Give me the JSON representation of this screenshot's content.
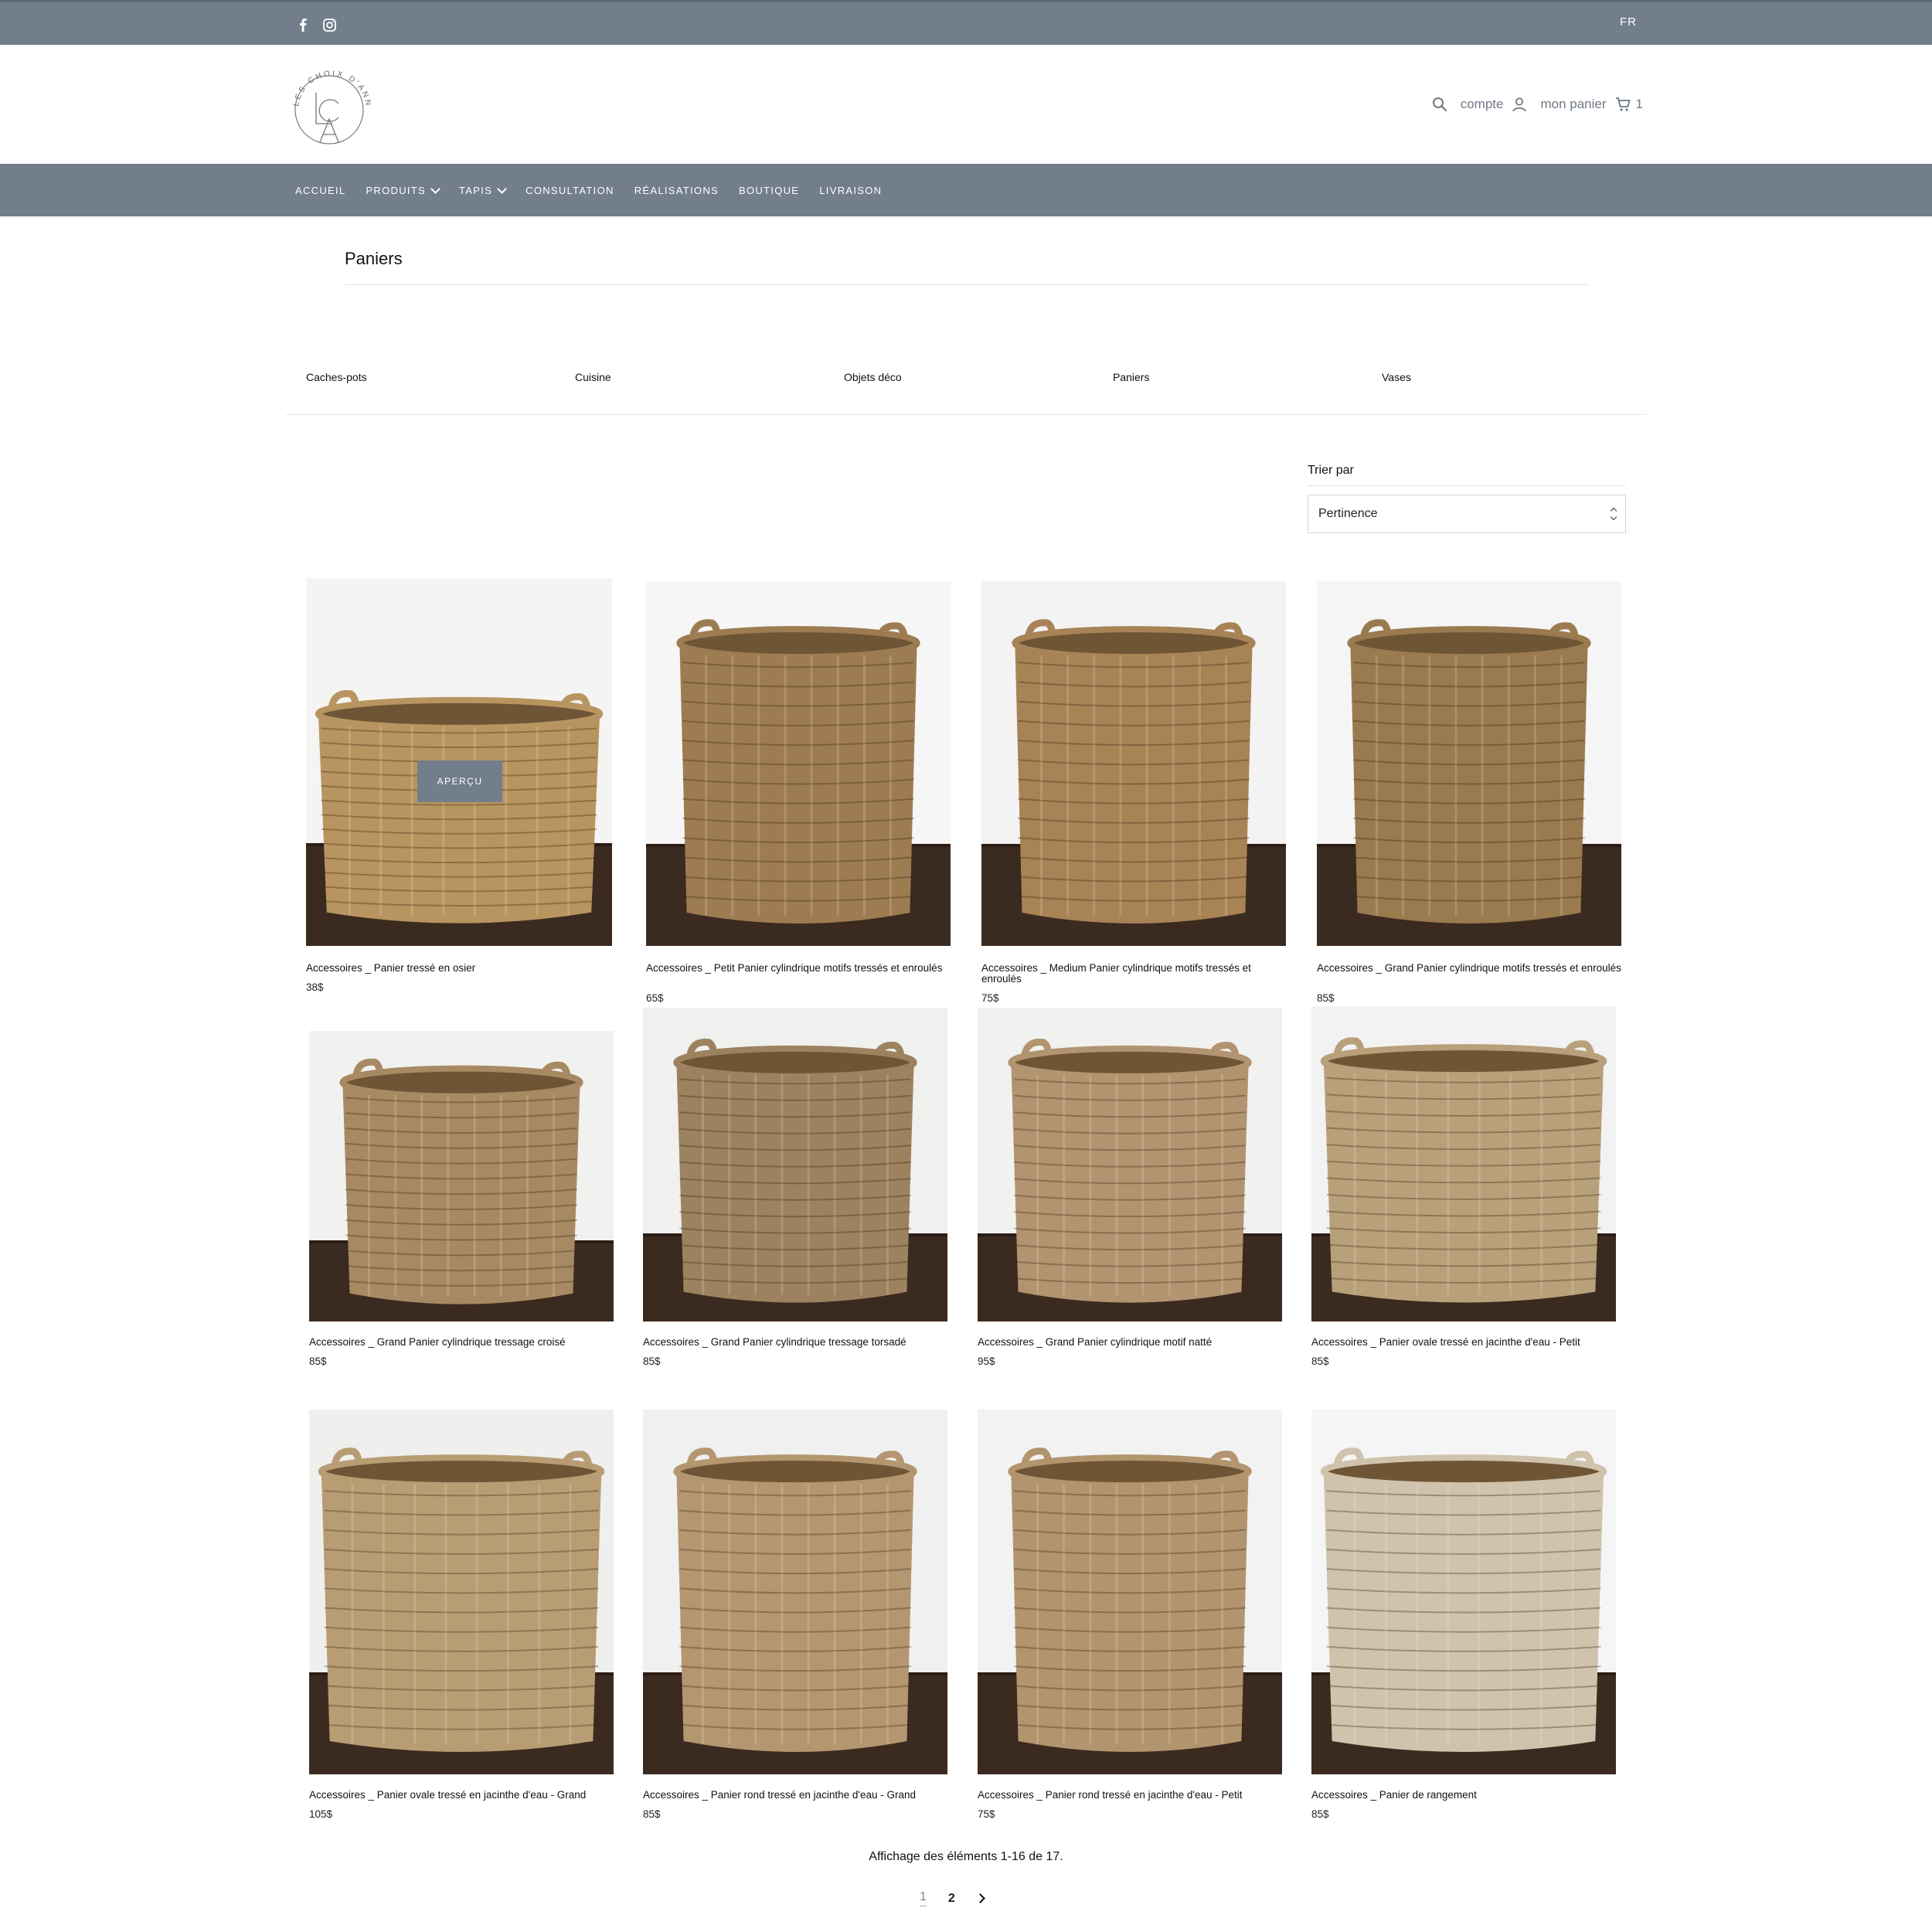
{
  "topbar": {
    "language": "FR",
    "social": [
      "facebook-icon",
      "instagram-icon"
    ]
  },
  "logo": {
    "text": "LES CHOIX D'ANNIE",
    "monogram": "LCA"
  },
  "header": {
    "account_label": "compte",
    "cart_label": "mon panier",
    "cart_count": "1"
  },
  "nav": [
    "ACCUEIL",
    "PRODUITS",
    "TAPIS",
    "CONSULTATION",
    "RÉALISATIONS",
    "BOUTIQUE",
    "LIVRAISON"
  ],
  "page": {
    "title": "Paniers"
  },
  "categories": [
    "Caches-pots",
    "Cuisine",
    "Objets déco",
    "Paniers",
    "Vases"
  ],
  "sort": {
    "label": "Trier par",
    "value": "Pertinence"
  },
  "quickview_label": "APERÇU",
  "products": [
    {
      "name": "Accessoires _ Panier tressé en osier",
      "price": "38$"
    },
    {
      "name": "Accessoires _ Petit Panier cylindrique motifs tressés et enroulés",
      "price": "65$"
    },
    {
      "name": "Accessoires _ Medium Panier cylindrique motifs tressés et enroulés",
      "price": "75$"
    },
    {
      "name": "Accessoires _ Grand Panier cylindrique motifs tressés et enroulés",
      "price": "85$"
    },
    {
      "name": "Accessoires _ Grand Panier cylindrique tressage croisé",
      "price": "85$"
    },
    {
      "name": "Accessoires _ Grand Panier cylindrique tressage torsadé",
      "price": "85$"
    },
    {
      "name": "Accessoires _ Grand Panier cylindrique motif natté",
      "price": "95$"
    },
    {
      "name": "Accessoires _ Panier ovale tressé en jacinthe d'eau - Petit",
      "price": "85$"
    },
    {
      "name": "Accessoires _ Panier ovale tressé en jacinthe d'eau - Grand",
      "price": "105$"
    },
    {
      "name": "Accessoires _ Panier rond tressé en jacinthe d'eau - Grand",
      "price": "85$"
    },
    {
      "name": "Accessoires _ Panier rond tressé en jacinthe d'eau - Petit",
      "price": "75$"
    },
    {
      "name": "Accessoires _ Panier de rangement",
      "price": "85$"
    }
  ],
  "pagination": {
    "info": "Affichage des éléments 1-16 de 17.",
    "pages": [
      "1",
      "2"
    ],
    "next_icon": "chevron-right-icon"
  }
}
